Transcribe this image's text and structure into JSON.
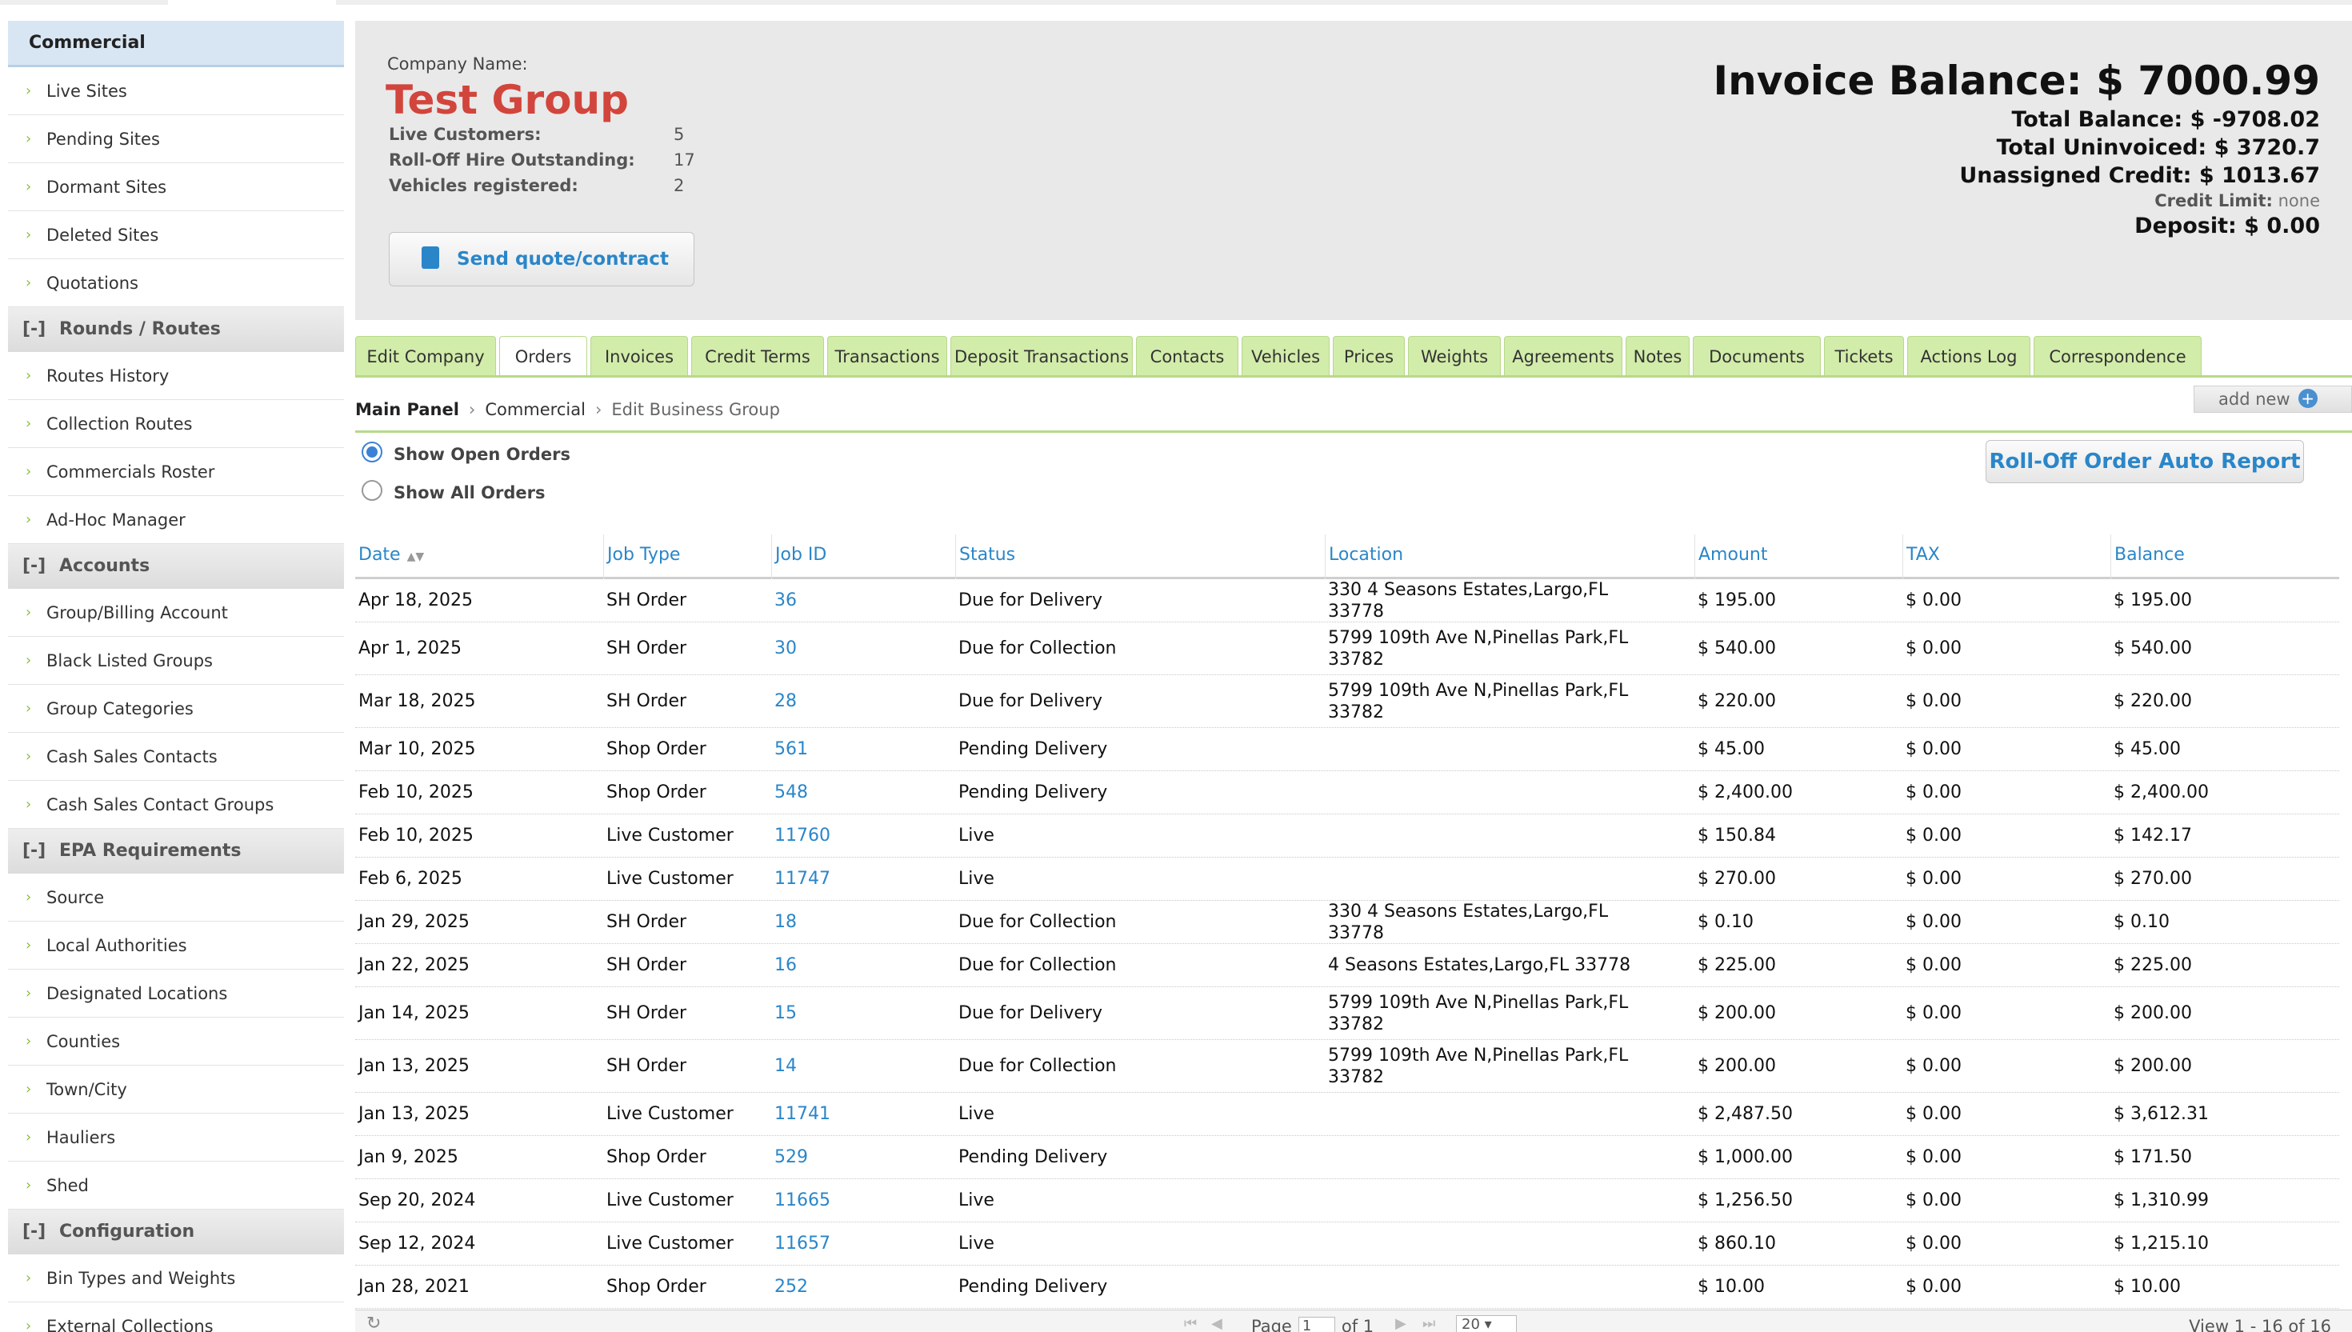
{
  "sidebar": {
    "header": "Commercial",
    "groups": [
      {
        "items": [
          "Live Sites",
          "Pending Sites",
          "Dormant Sites",
          "Deleted Sites",
          "Quotations"
        ]
      },
      {
        "toggle": "[-]",
        "title": "Rounds / Routes",
        "items": [
          "Routes History",
          "Collection Routes",
          "Commercials Roster",
          "Ad-Hoc Manager"
        ]
      },
      {
        "toggle": "[-]",
        "title": "Accounts",
        "items": [
          "Group/Billing Account",
          "Black Listed Groups",
          "Group Categories",
          "Cash Sales Contacts",
          "Cash Sales Contact Groups"
        ]
      },
      {
        "toggle": "[-]",
        "title": "EPA Requirements",
        "items": [
          "Source",
          "Local Authorities",
          "Designated Locations",
          "Counties",
          "Town/City",
          "Hauliers",
          "Shed"
        ]
      },
      {
        "toggle": "[-]",
        "title": "Configuration",
        "items": [
          "Bin Types and Weights",
          "External Collections"
        ]
      }
    ]
  },
  "company": {
    "name_label": "Company Name:",
    "name": "Test Group",
    "stats": [
      {
        "label": "Live Customers:",
        "value": "5"
      },
      {
        "label": "Roll-Off Hire Outstanding:",
        "value": "17"
      },
      {
        "label": "Vehicles registered:",
        "value": "2"
      }
    ],
    "send_button": "Send quote/contract"
  },
  "balances": {
    "invoice_balance": "Invoice Balance: $ 7000.99",
    "total_balance": "Total Balance: $ -9708.02",
    "total_uninvoiced": "Total Uninvoiced: $ 3720.7",
    "unassigned_credit": "Unassigned Credit: $ 1013.67",
    "credit_limit_label": "Credit Limit:",
    "credit_limit_value": "none",
    "deposit": "Deposit: $ 0.00"
  },
  "tabs": [
    "Edit Company",
    "Orders",
    "Invoices",
    "Credit Terms",
    "Transactions",
    "Deposit Transactions",
    "Contacts",
    "Vehicles",
    "Prices",
    "Weights",
    "Agreements",
    "Notes",
    "Documents",
    "Tickets",
    "Actions Log",
    "Correspondence"
  ],
  "active_tab": "Orders",
  "breadcrumb": {
    "root": "Main Panel",
    "section": "Commercial",
    "current": "Edit Business Group"
  },
  "add_new": "add new",
  "filters": {
    "open": "Show Open Orders",
    "all": "Show All Orders"
  },
  "report_button": "Roll-Off Order Auto Report",
  "table": {
    "columns": [
      "Date",
      "Job Type",
      "Job ID",
      "Status",
      "Location",
      "Amount",
      "TAX",
      "Balance"
    ],
    "rows": [
      [
        "Apr 18, 2025",
        "SH Order",
        "36",
        "Due for Delivery",
        "330 4 Seasons Estates,Largo,FL 33778",
        "$ 195.00",
        "$ 0.00",
        "$ 195.00"
      ],
      [
        "Apr 1, 2025",
        "SH Order",
        "30",
        "Due for Collection",
        "5799 109th Ave N,Pinellas Park,FL 33782",
        "$ 540.00",
        "$ 0.00",
        "$ 540.00"
      ],
      [
        "Mar 18, 2025",
        "SH Order",
        "28",
        "Due for Delivery",
        "5799 109th Ave N,Pinellas Park,FL 33782",
        "$ 220.00",
        "$ 0.00",
        "$ 220.00"
      ],
      [
        "Mar 10, 2025",
        "Shop Order",
        "561",
        "Pending Delivery",
        "",
        "$ 45.00",
        "$ 0.00",
        "$ 45.00"
      ],
      [
        "Feb 10, 2025",
        "Shop Order",
        "548",
        "Pending Delivery",
        "",
        "$ 2,400.00",
        "$ 0.00",
        "$ 2,400.00"
      ],
      [
        "Feb 10, 2025",
        "Live Customer",
        "11760",
        "Live",
        "",
        "$ 150.84",
        "$ 0.00",
        "$ 142.17"
      ],
      [
        "Feb 6, 2025",
        "Live Customer",
        "11747",
        "Live",
        "",
        "$ 270.00",
        "$ 0.00",
        "$ 270.00"
      ],
      [
        "Jan 29, 2025",
        "SH Order",
        "18",
        "Due for Collection",
        "330 4 Seasons Estates,Largo,FL 33778",
        "$ 0.10",
        "$ 0.00",
        "$ 0.10"
      ],
      [
        "Jan 22, 2025",
        "SH Order",
        "16",
        "Due for Collection",
        "4 Seasons Estates,Largo,FL 33778",
        "$ 225.00",
        "$ 0.00",
        "$ 225.00"
      ],
      [
        "Jan 14, 2025",
        "SH Order",
        "15",
        "Due for Delivery",
        "5799 109th Ave N,Pinellas Park,FL 33782",
        "$ 200.00",
        "$ 0.00",
        "$ 200.00"
      ],
      [
        "Jan 13, 2025",
        "SH Order",
        "14",
        "Due for Collection",
        "5799 109th Ave N,Pinellas Park,FL 33782",
        "$ 200.00",
        "$ 0.00",
        "$ 200.00"
      ],
      [
        "Jan 13, 2025",
        "Live Customer",
        "11741",
        "Live",
        "",
        "$ 2,487.50",
        "$ 0.00",
        "$ 3,612.31"
      ],
      [
        "Jan 9, 2025",
        "Shop Order",
        "529",
        "Pending Delivery",
        "",
        "$ 1,000.00",
        "$ 0.00",
        "$ 171.50"
      ],
      [
        "Sep 20, 2024",
        "Live Customer",
        "11665",
        "Live",
        "",
        "$ 1,256.50",
        "$ 0.00",
        "$ 1,310.99"
      ],
      [
        "Sep 12, 2024",
        "Live Customer",
        "11657",
        "Live",
        "",
        "$ 860.10",
        "$ 0.00",
        "$ 1,215.10"
      ],
      [
        "Jan 28, 2021",
        "Shop Order",
        "252",
        "Pending Delivery",
        "",
        "$ 10.00",
        "$ 0.00",
        "$ 10.00"
      ]
    ]
  },
  "pager": {
    "page_label": "Page",
    "page_value": "1",
    "of_label": "of 1",
    "per_page": "20",
    "view_text": "View 1 - 16 of 16"
  },
  "colors": {
    "accent": "#2a86c9",
    "company_name": "#d2453c",
    "tab_bg": "#d2ecaa",
    "chevron": "#8bbf3a"
  }
}
